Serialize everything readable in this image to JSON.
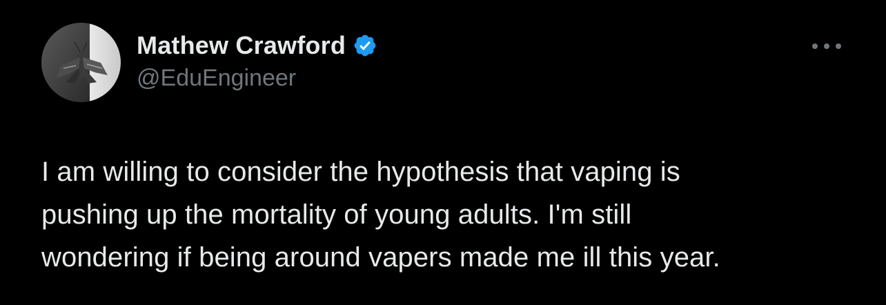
{
  "tweet": {
    "author": {
      "display_name": "Mathew Crawford",
      "handle": "@EduEngineer",
      "verified": true,
      "avatar_icon": "moth-avatar-icon",
      "verified_icon": "verified-badge-icon",
      "verified_color": "#1d9bf0"
    },
    "more_icon": "more-options-icon",
    "text": "I am willing to consider the hypothesis that vaping is\npushing up the mortality of young adults. I'm still\nwondering if being around vapers made me ill this year."
  },
  "colors": {
    "background": "#000000",
    "primary_text": "#e7e9ea",
    "secondary_text": "#71767b",
    "accent": "#1d9bf0"
  }
}
